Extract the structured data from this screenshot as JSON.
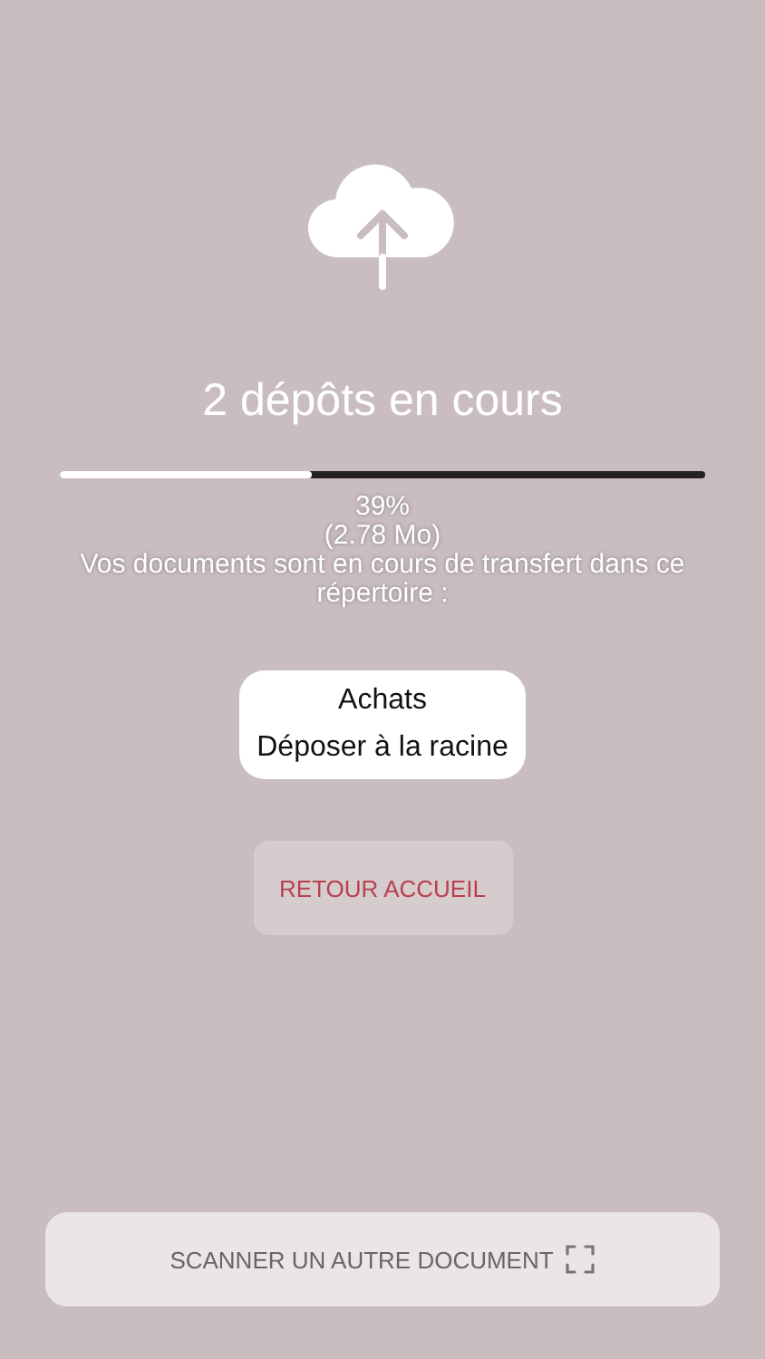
{
  "title": "2 dépôts en cours",
  "progress": {
    "level": 0.39,
    "percent": "39%",
    "size": "(2.78 Mo)"
  },
  "message": "Vos documents sont en cours de transfert dans ce répertoire :",
  "destination": [
    "Achats",
    "Déposer à la racine"
  ],
  "home_button": {
    "label": "RETOUR ACCUEIL",
    "disabled": true
  },
  "scan_button": {
    "label": "SCANNER UN AUTRE DOCUMENT"
  }
}
